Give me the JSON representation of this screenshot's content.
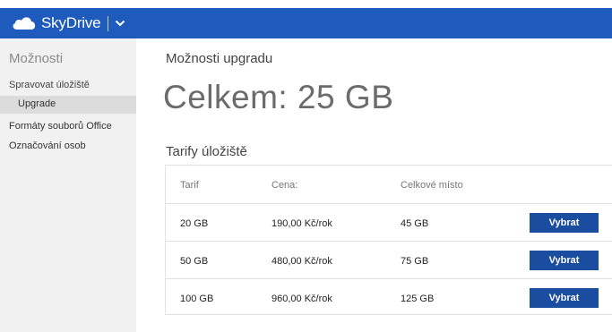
{
  "header": {
    "app_name": "SkyDrive",
    "brand_color": "#1e5bbd"
  },
  "sidebar": {
    "title": "Možnosti",
    "items": [
      {
        "label": "Spravovat úložiště"
      },
      {
        "label": "Upgrade",
        "selected": true
      },
      {
        "label": "Formáty souborů Office"
      },
      {
        "label": "Označování osob"
      }
    ]
  },
  "main": {
    "title": "Možnosti upgradu",
    "total": "Celkem: 25 GB",
    "plans_title": "Tarify úložiště",
    "columns": [
      "Tarif",
      "Cena:",
      "Celkové místo"
    ],
    "plans": [
      {
        "plan": "20 GB",
        "price": "190,00 Kč/rok",
        "total_space": "45 GB",
        "button": "Vybrat"
      },
      {
        "plan": "50 GB",
        "price": "480,00 Kč/rok",
        "total_space": "75 GB",
        "button": "Vybrat"
      },
      {
        "plan": "100 GB",
        "price": "960,00 Kč/rok",
        "total_space": "125 GB",
        "button": "Vybrat"
      }
    ],
    "button_color": "#1a4ca0"
  }
}
